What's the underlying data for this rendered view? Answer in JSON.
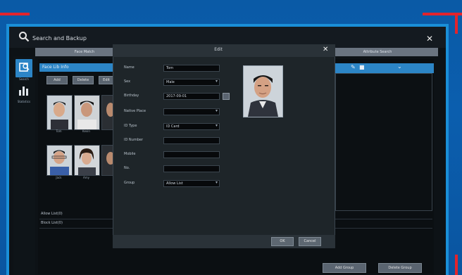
{
  "window": {
    "title": "Search and Backup"
  },
  "tabs": [
    "Face Match",
    "Attribute Search"
  ],
  "sidebar": [
    {
      "icon": "face-search-icon",
      "label": "Search"
    },
    {
      "icon": "bar-chart-icon",
      "label": "Statistics"
    }
  ],
  "list": {
    "header": "Face Lib Info",
    "buttons": [
      "Add",
      "Delete",
      "Edit"
    ],
    "faces": [
      {
        "caption": "Tom"
      },
      {
        "caption": "Kevin"
      },
      {
        "caption": ""
      },
      {
        "caption": "Jack"
      },
      {
        "caption": "Amy"
      },
      {
        "caption": ""
      }
    ]
  },
  "rows": [
    {
      "left": "Allow List(0)"
    },
    {
      "left": "Block List(0)"
    }
  ],
  "bottom_buttons": [
    "Add Group",
    "Delete Group"
  ],
  "modal": {
    "title": "Edit",
    "fields": [
      {
        "label": "Name",
        "value": "Tom",
        "type": "text"
      },
      {
        "label": "Sex",
        "value": "Male",
        "type": "select"
      },
      {
        "label": "Birthday",
        "value": "2017-09-01",
        "type": "date"
      },
      {
        "label": "Native Place",
        "value": "",
        "type": "select"
      },
      {
        "label": "ID Type",
        "value": "ID Card",
        "type": "select"
      },
      {
        "label": "ID Number",
        "value": "",
        "type": "text"
      },
      {
        "label": "Mobile",
        "value": "",
        "type": "text"
      },
      {
        "label": "No.",
        "value": "",
        "type": "text"
      },
      {
        "label": "Group",
        "value": "Allow List",
        "type": "select"
      }
    ],
    "ok_label": "OK",
    "cancel_label": "Cancel"
  },
  "colors": {
    "accent": "#2c85c6",
    "frame": "#1a8fd8",
    "corner": "#e2242c",
    "background": "#0a5aa6"
  }
}
